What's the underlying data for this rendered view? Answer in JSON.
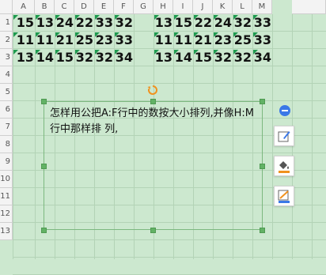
{
  "columns": [
    "A",
    "B",
    "C",
    "D",
    "E",
    "F",
    "G",
    "H",
    "I",
    "J",
    "K",
    "L",
    "M"
  ],
  "rows": [
    "1",
    "2",
    "3",
    "4",
    "5",
    "6",
    "7",
    "8",
    "9",
    "10",
    "11",
    "12",
    "13"
  ],
  "cells": [
    {
      "row": 0,
      "values": [
        "15",
        "13",
        "24",
        "22",
        "33",
        "32",
        "",
        "13",
        "15",
        "22",
        "24",
        "32",
        "33"
      ]
    },
    {
      "row": 1,
      "values": [
        "11",
        "11",
        "21",
        "25",
        "23",
        "33",
        "",
        "11",
        "11",
        "21",
        "23",
        "25",
        "33"
      ]
    },
    {
      "row": 2,
      "values": [
        "13",
        "14",
        "15",
        "32",
        "32",
        "34",
        "",
        "13",
        "14",
        "15",
        "32",
        "32",
        "34"
      ]
    }
  ],
  "textbox": {
    "text": "怎样用公把A:F行中的数按大小排列,并像H:M行中那样排 列,"
  },
  "toolbar": {
    "icons": [
      "collapse-minus-icon",
      "edit-shape-icon",
      "fill-bucket-icon",
      "outline-icon"
    ]
  },
  "colors": {
    "background": "#cce8cf",
    "accent": "#3b78e7",
    "handle": "#62b265",
    "rotate": "#f0921f"
  }
}
